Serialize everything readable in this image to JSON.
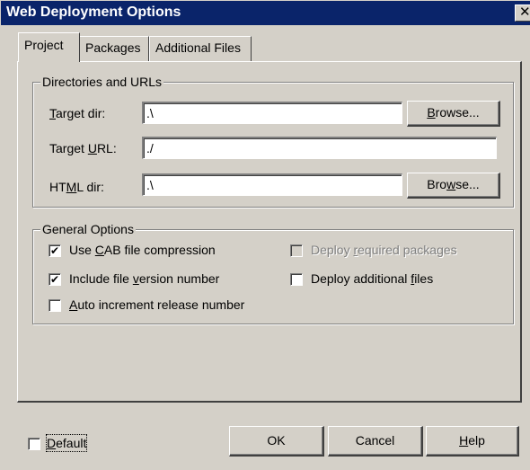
{
  "window": {
    "title": "Web Deployment Options",
    "close_glyph": "✕"
  },
  "tabs": [
    {
      "label": "Project",
      "active": true
    },
    {
      "label": "Packages",
      "active": false
    },
    {
      "label": "Additional Files",
      "active": false
    }
  ],
  "directories": {
    "group_label": "Directories and URLs",
    "target_dir": {
      "label_pre": "",
      "label_mnemonic": "T",
      "label_post": "arget dir:",
      "value": ".\\",
      "browse_pre": "",
      "browse_mnemonic": "B",
      "browse_post": "rowse..."
    },
    "target_url": {
      "label_pre": "Target ",
      "label_mnemonic": "U",
      "label_post": "RL:",
      "value": "./"
    },
    "html_dir": {
      "label_pre": "HT",
      "label_mnemonic": "M",
      "label_post": "L dir:",
      "value": ".\\",
      "browse_pre": "Bro",
      "browse_mnemonic": "w",
      "browse_post": "se..."
    }
  },
  "general": {
    "group_label": "General Options",
    "options": [
      {
        "pre": "Use ",
        "mnemonic": "C",
        "post": "AB file compression",
        "checked": true,
        "enabled": true
      },
      {
        "pre": "Include file ",
        "mnemonic": "v",
        "post": "ersion number",
        "checked": true,
        "enabled": true
      },
      {
        "pre": "",
        "mnemonic": "A",
        "post": "uto increment release number",
        "checked": false,
        "enabled": true
      },
      {
        "pre": "Deploy ",
        "mnemonic": "r",
        "post": "equired packages",
        "checked": false,
        "enabled": false
      },
      {
        "pre": "Deploy additional ",
        "mnemonic": "f",
        "post": "iles",
        "checked": false,
        "enabled": true
      }
    ]
  },
  "footer": {
    "default": {
      "pre": "",
      "mnemonic": "D",
      "post": "efault",
      "checked": false
    },
    "ok_label": "OK",
    "cancel_label": "Cancel",
    "help": {
      "pre": "",
      "mnemonic": "H",
      "post": "elp"
    }
  },
  "check_glyph": "✔"
}
